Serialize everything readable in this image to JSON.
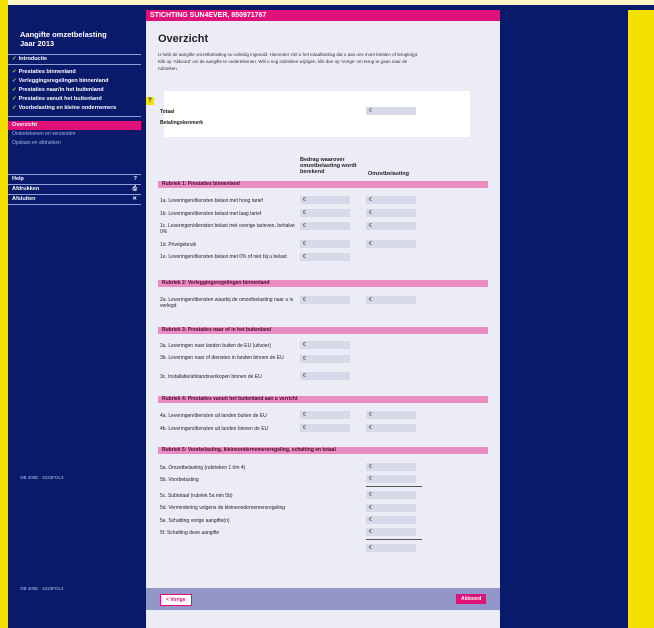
{
  "header": {
    "org": "STICHTING SUN4EVER, 850971767"
  },
  "sidebar": {
    "title1": "Aangifte omzetbelasting",
    "title2": "Jaar 2013",
    "items": [
      {
        "label": "Introductie",
        "checked": true
      },
      {
        "label": "Prestaties binnenland",
        "checked": true
      },
      {
        "label": "Verleggingsregelingen binnenland",
        "checked": true
      },
      {
        "label": "Prestaties naar/in het buitenland",
        "checked": true
      },
      {
        "label": "Prestaties vanuit het buitenland",
        "checked": true
      },
      {
        "label": "Voorbelasting en kleine ondernemers",
        "checked": true
      }
    ],
    "active": "Overzicht",
    "sub": [
      "Ondertekenen en verzenden",
      "Opslaan en afdrukken"
    ],
    "util": [
      {
        "label": "Help",
        "icon": "help-icon"
      },
      {
        "label": "Afdrukken",
        "icon": "print-icon"
      },
      {
        "label": "Afsluiten",
        "icon": "close-icon"
      }
    ],
    "footer1": "OB 400E - 2223FOL3",
    "footer2": "OB 400E - 2223FOL3"
  },
  "main": {
    "title": "Overzicht",
    "intro": "U hebt de aangifte omzetbelasting nu volledig ingevuld. Hieronder ziet u het totaalbedrag dat u aan ons moet betalen of terugkrijgt. Klik op 'Akkoord' om de aangifte te ondertekenen. Wilt u nog rubrieken wijzigen, klik dan op 'Vorige' om terug te gaan naar de rubrieken.",
    "totaal_label": "Totaal",
    "betaling_label": "Betalingskenmerk",
    "currency": "€",
    "col1": "Bedrag waarover omzetbelasting wordt berekend",
    "col2": "Omzetbelasting",
    "sections": [
      {
        "title": "Rubriek 1: Prestaties binnenland",
        "rows": [
          "1a. Leveringen/diensten belast met hoog tarief",
          "1b. Leveringen/diensten belast met laag tarief",
          "1c. Leveringen/diensten belast met overige tarieven, behalve 0%",
          "1d. Privégebruik",
          "1e. Leveringen/diensten belast met 0% of niet bij u belast"
        ]
      },
      {
        "title": "Rubriek 2: Verleggingsregelingen binnenland",
        "rows": [
          "2a. Leveringen/diensten waarbij de omzetbelasting naar u is verlegd"
        ]
      },
      {
        "title": "Rubriek 3: Prestaties naar of in het buitenland",
        "rows": [
          "3a. Leveringen naar landen buiten de EU (uitvoer)",
          "3b. Leveringen naar of diensten in landen binnen de EU",
          "3c. Installatie/afstandsverkopen binnen de EU"
        ]
      },
      {
        "title": "Rubriek 4: Prestaties vanuit het buitenland aan u verricht",
        "rows": [
          "4a. Leveringen/diensten uit landen buiten de EU",
          "4b. Leveringen/diensten uit landen binnen de EU"
        ]
      },
      {
        "title": "Rubriek 5: Voorbelasting, kleineondernemersregeling, schatting en totaal",
        "rows": [
          "5a. Omzetbelasting (rubrieken 1 t/m 4)",
          "5b. Voorbelasting",
          "5c. Subtotaal (rubriek 5a min 5b)",
          "5d. Vermindering volgens de kleineondernemersregeling",
          "5e. Schatting vorige aangifte(n)",
          "5f. Schatting deze aangifte"
        ]
      }
    ],
    "prev_label": "< Vorige",
    "ok_label": "Akkoord"
  },
  "colors": {
    "accent": "#e0127a",
    "navy": "#0a1a6b",
    "section": "#e88cc2",
    "input": "#d6d9e8"
  }
}
